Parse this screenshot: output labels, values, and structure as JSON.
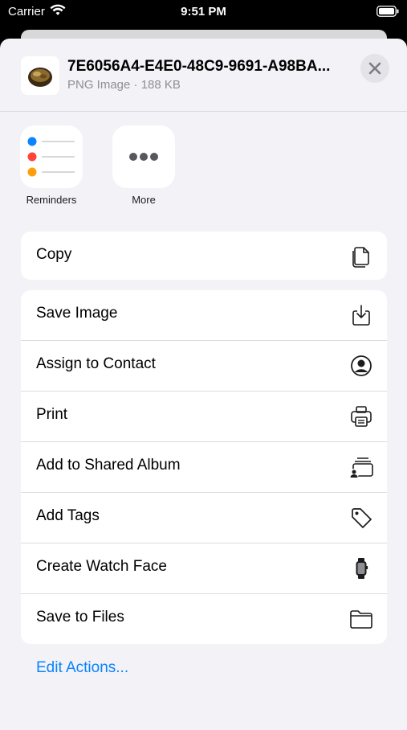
{
  "status_bar": {
    "carrier": "Carrier",
    "time": "9:51 PM"
  },
  "file": {
    "name": "7E6056A4-E4E0-48C9-9691-A98BA...",
    "subtitle": "PNG Image · 188 KB"
  },
  "apps": [
    {
      "label": "Reminders",
      "icon": "reminders-icon"
    },
    {
      "label": "More",
      "icon": "more-icon"
    }
  ],
  "actions_group1": [
    {
      "label": "Copy",
      "icon": "copy-icon"
    }
  ],
  "actions_group2": [
    {
      "label": "Save Image",
      "icon": "save-image-icon"
    },
    {
      "label": "Assign to Contact",
      "icon": "contact-icon"
    },
    {
      "label": "Print",
      "icon": "printer-icon"
    },
    {
      "label": "Add to Shared Album",
      "icon": "shared-album-icon"
    },
    {
      "label": "Add Tags",
      "icon": "tag-icon"
    },
    {
      "label": "Create Watch Face",
      "icon": "watch-icon"
    },
    {
      "label": "Save to Files",
      "icon": "folder-icon"
    }
  ],
  "edit_actions": "Edit Actions...",
  "colors": {
    "accent": "#0a84ff",
    "sheet_bg": "#f2f2f7",
    "card_bg": "#ffffff"
  }
}
